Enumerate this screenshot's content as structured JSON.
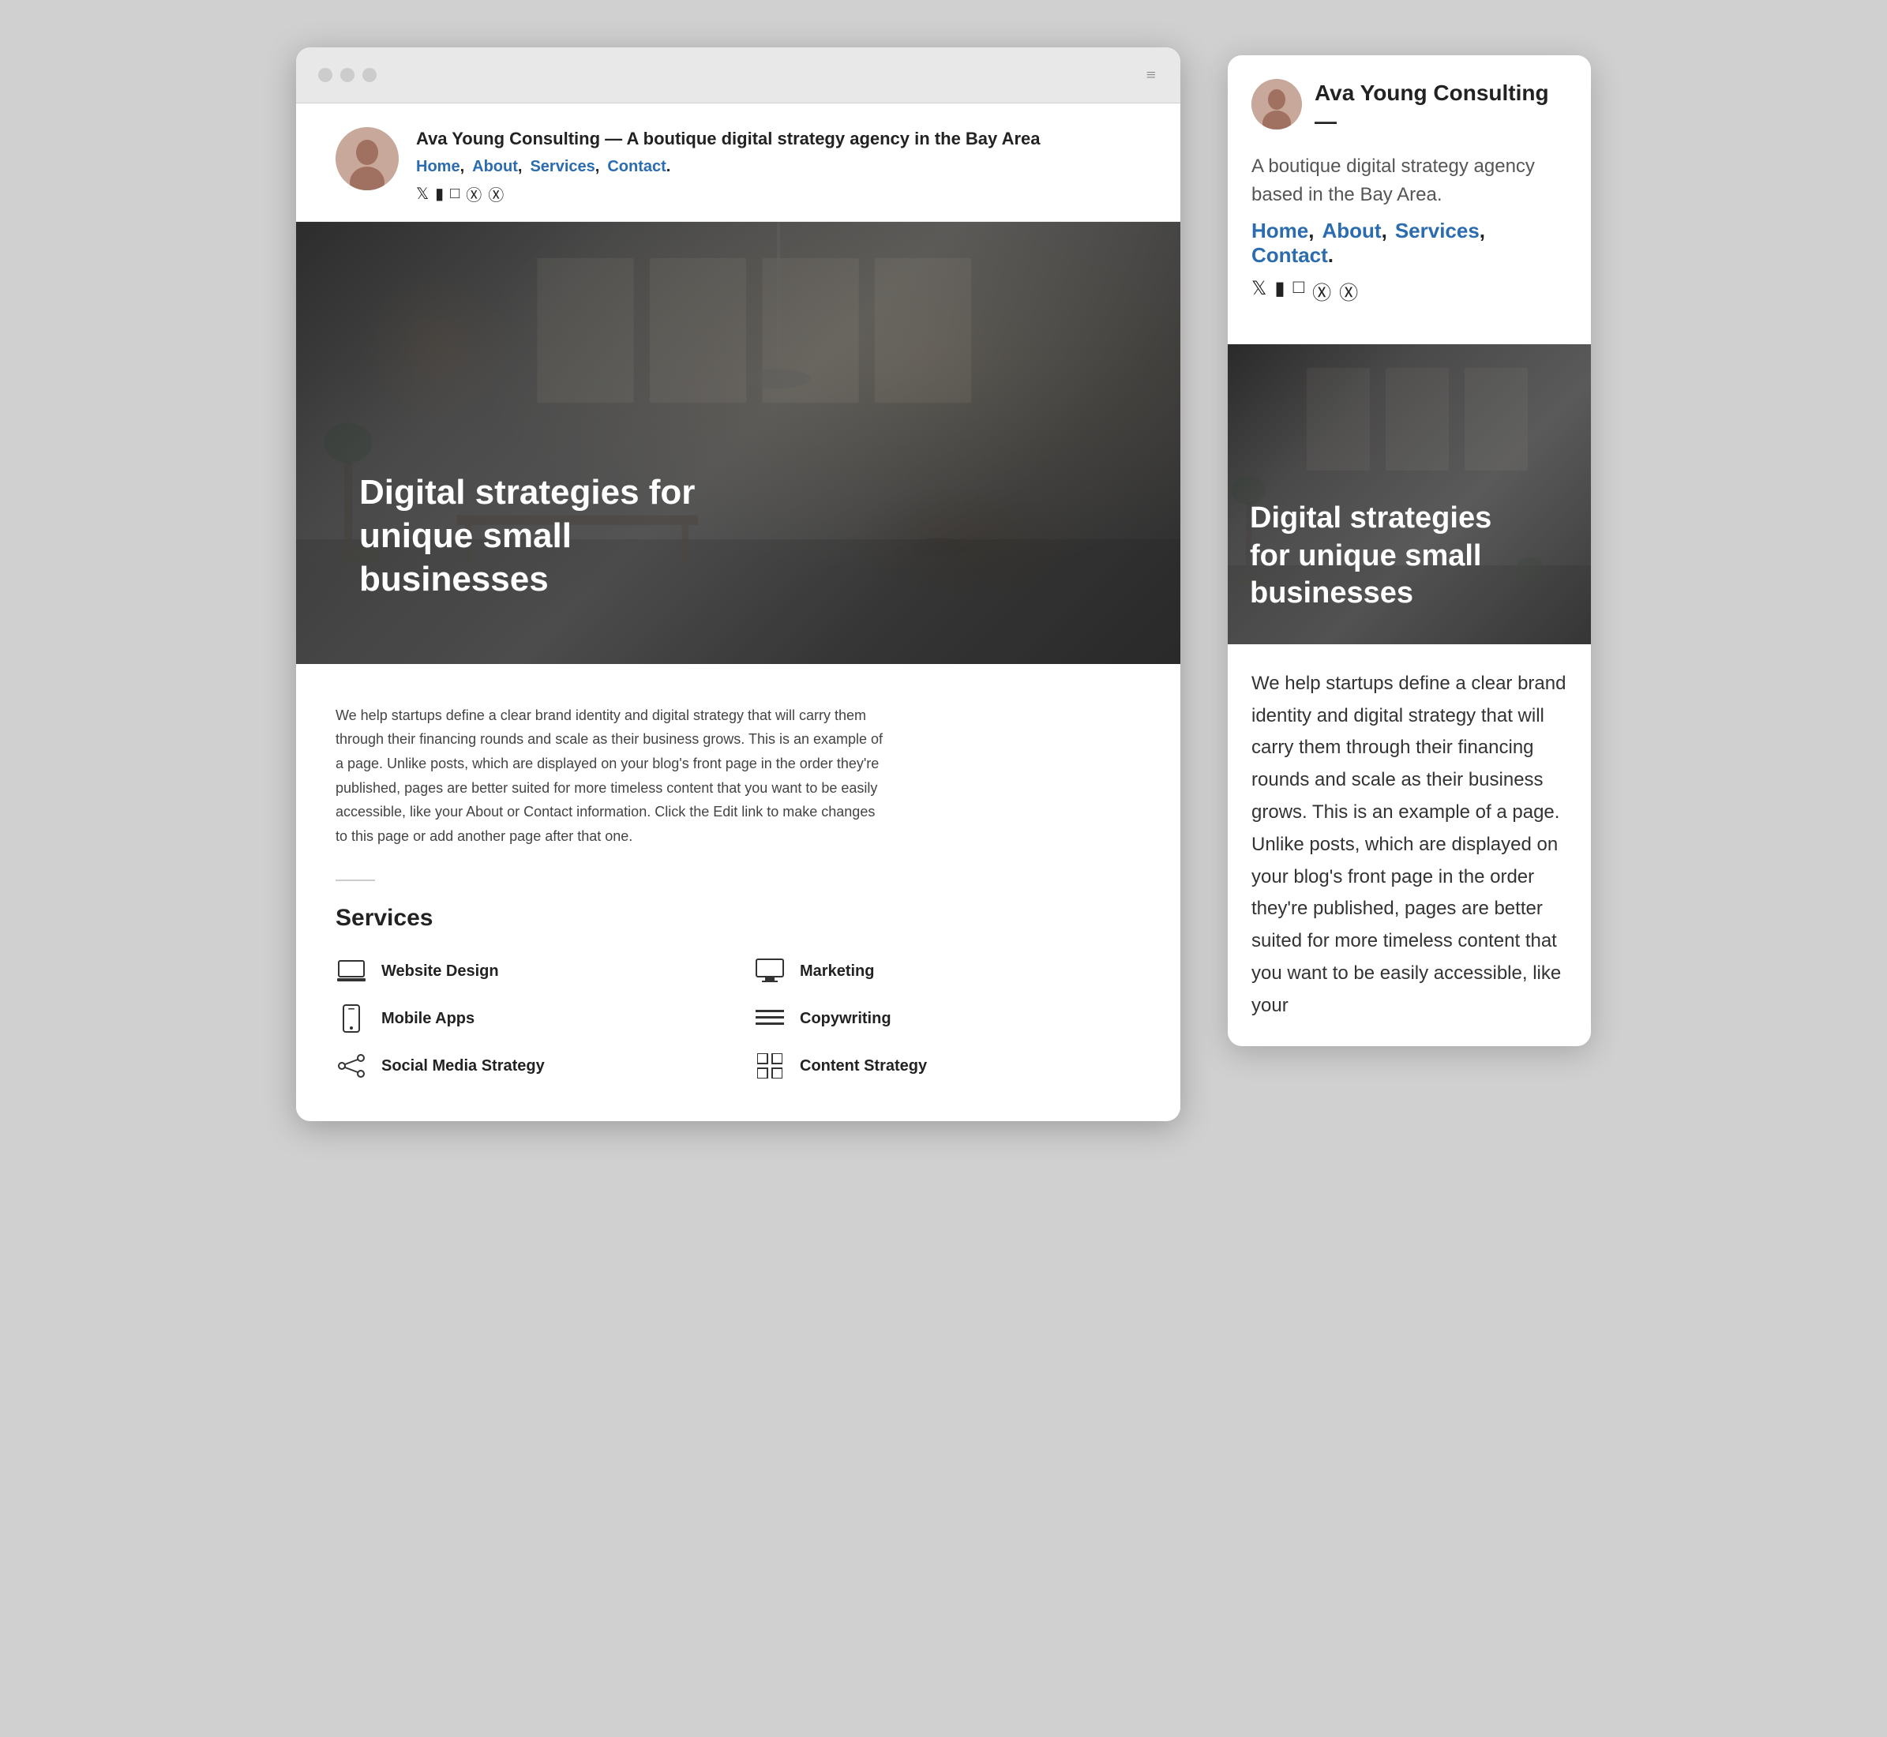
{
  "browser": {
    "dots": [
      "dot1",
      "dot2",
      "dot3"
    ],
    "menu_icon": "≡"
  },
  "site": {
    "name": "Ava Young Consulting",
    "tagline_dash": "—",
    "tagline": "A boutique digital strategy agency in the Bay Area",
    "tagline_mobile": "A boutique digital strategy agency based in the Bay Area.",
    "nav": [
      "Home",
      "About",
      "Services",
      "Contact"
    ],
    "hero_title": "Digital strategies for unique small businesses",
    "intro": "We help startups define a clear brand identity and digital strategy that will carry them through their financing rounds and scale as their business grows. This is an example of a page. Unlike posts, which are displayed on your blog's front page in the order they're published, pages are better suited for more timeless content that you want to be easily accessible, like your About or Contact information. Click the Edit link to make changes to this page or add another page after that one.",
    "intro_mobile": "We help startups define a clear brand identity and digital strategy that will carry them through their financing rounds and scale as their business grows. This is an example of a page. Unlike posts, which are displayed on your blog's front page in the order they're published, pages are better suited for more timeless content that you want to be easily accessible, like your",
    "services_heading": "Services",
    "services": [
      {
        "label": "Website Design",
        "icon": "laptop"
      },
      {
        "label": "Marketing",
        "icon": "monitor"
      },
      {
        "label": "Mobile Apps",
        "icon": "phone"
      },
      {
        "label": "Copywriting",
        "icon": "lines"
      },
      {
        "label": "Social Media Strategy",
        "icon": "share"
      },
      {
        "label": "Content Strategy",
        "icon": "grid"
      }
    ]
  }
}
